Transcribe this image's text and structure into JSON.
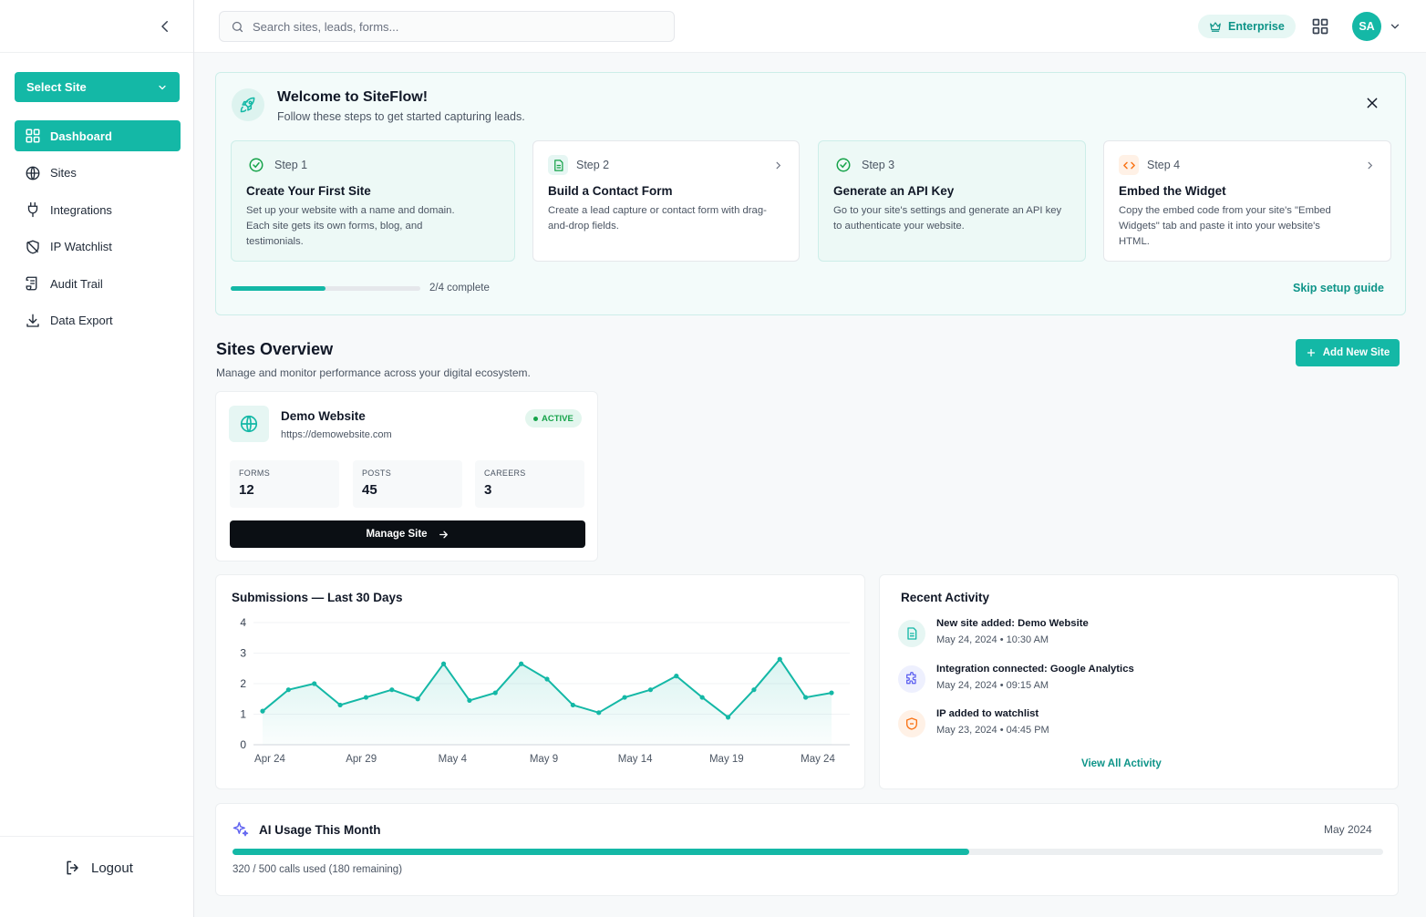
{
  "sidebar": {
    "select_site_label": "Select Site",
    "items": [
      {
        "label": "Dashboard",
        "icon": "dashboard-grid-icon",
        "active": true
      },
      {
        "label": "Sites",
        "icon": "globe-icon"
      },
      {
        "label": "Integrations",
        "icon": "plug-icon"
      },
      {
        "label": "IP Watchlist",
        "icon": "shield-off-icon"
      },
      {
        "label": "Audit Trail",
        "icon": "scroll-icon"
      },
      {
        "label": "Data Export",
        "icon": "download-icon"
      }
    ],
    "logout_label": "Logout"
  },
  "header": {
    "search_placeholder": "Search sites, leads, forms...",
    "plan_badge": "Enterprise",
    "avatar_initials": "SA"
  },
  "welcome": {
    "title": "Welcome to SiteFlow!",
    "subtitle": "Follow these steps to get started capturing leads.",
    "steps": [
      {
        "step": "Step 1",
        "title": "Create Your First Site",
        "desc": "Set up your website with a name and domain. Each site gets its own forms, blog, and testimonials.",
        "done": true
      },
      {
        "step": "Step 2",
        "title": "Build a Contact Form",
        "desc": "Create a lead capture or contact form with drag-and-drop fields.",
        "done": false
      },
      {
        "step": "Step 3",
        "title": "Generate an API Key",
        "desc": "Go to your site's settings and generate an API key to authenticate your website.",
        "done": true
      },
      {
        "step": "Step 4",
        "title": "Embed the Widget",
        "desc": "Copy the embed code from your site's \"Embed Widgets\" tab and paste it into your website's HTML.",
        "done": false
      }
    ],
    "progress_fraction": 0.5,
    "progress_label": "2/4 complete",
    "skip_label": "Skip setup guide"
  },
  "sites_overview": {
    "title": "Sites Overview",
    "subtitle": "Manage and monitor performance across your digital ecosystem.",
    "add_button": "Add New Site",
    "site": {
      "name": "Demo Website",
      "url": "https://demowebsite.com",
      "status": "ACTIVE",
      "stats": [
        {
          "label": "FORMS",
          "value": "12"
        },
        {
          "label": "POSTS",
          "value": "45"
        },
        {
          "label": "CAREERS",
          "value": "3"
        }
      ],
      "manage_label": "Manage Site"
    }
  },
  "chart_data": {
    "type": "area",
    "title": "Submissions — Last 30 Days",
    "x_tick_labels": [
      "Apr 24",
      "Apr 29",
      "May 4",
      "May 9",
      "May 14",
      "May 19",
      "May 24"
    ],
    "yticks": [
      0,
      1,
      2,
      3,
      4
    ],
    "ylim": [
      0,
      4
    ],
    "x": [
      "Apr 24",
      "Apr 25",
      "Apr 26",
      "Apr 27",
      "Apr 28",
      "Apr 29",
      "Apr 30",
      "May 1",
      "May 2",
      "May 3",
      "May 4",
      "May 5",
      "May 6",
      "May 7",
      "May 8",
      "May 9",
      "May 10",
      "May 11",
      "May 12",
      "May 13",
      "May 14",
      "May 15",
      "May 16",
      "May 17",
      "May 18",
      "May 19",
      "May 20",
      "May 21",
      "May 22",
      "May 23",
      "May 24"
    ],
    "values": [
      1.1,
      1.8,
      2.0,
      1.3,
      1.55,
      1.8,
      1.5,
      2.65,
      1.45,
      1.7,
      2.65,
      2.15,
      1.3,
      1.05,
      1.55,
      1.8,
      2.25,
      1.55,
      0.9,
      1.8,
      2.8,
      1.55,
      1.7
    ],
    "series_x_index": [
      0,
      1,
      2,
      3,
      4,
      5,
      6,
      7,
      8,
      9,
      10,
      11,
      12,
      13,
      14,
      15,
      16,
      17,
      18,
      19,
      20,
      21,
      22
    ],
    "grid": true,
    "colors": {
      "line": "#14b8a6",
      "fill": "#14b8a6"
    }
  },
  "activity": {
    "title": "Recent Activity",
    "items": [
      {
        "text": "New site added: Demo Website",
        "time": "May 24, 2024 • 10:30 AM",
        "icon": "document-icon",
        "color": "#14b8a6",
        "bg": "#e6f6f3"
      },
      {
        "text": "Integration connected: Google Analytics",
        "time": "May 24, 2024 • 09:15 AM",
        "icon": "puzzle-icon",
        "color": "#6366f1",
        "bg": "#eef0fe"
      },
      {
        "text": "IP added to watchlist",
        "time": "May 23, 2024 • 04:45 PM",
        "icon": "shield-icon",
        "color": "#f97316",
        "bg": "#fff1e6"
      }
    ],
    "view_all": "View All Activity"
  },
  "ai_usage": {
    "title": "AI Usage This Month",
    "month": "May 2024",
    "used": 320,
    "total": 500,
    "label": "320 / 500 calls used (180 remaining)"
  }
}
